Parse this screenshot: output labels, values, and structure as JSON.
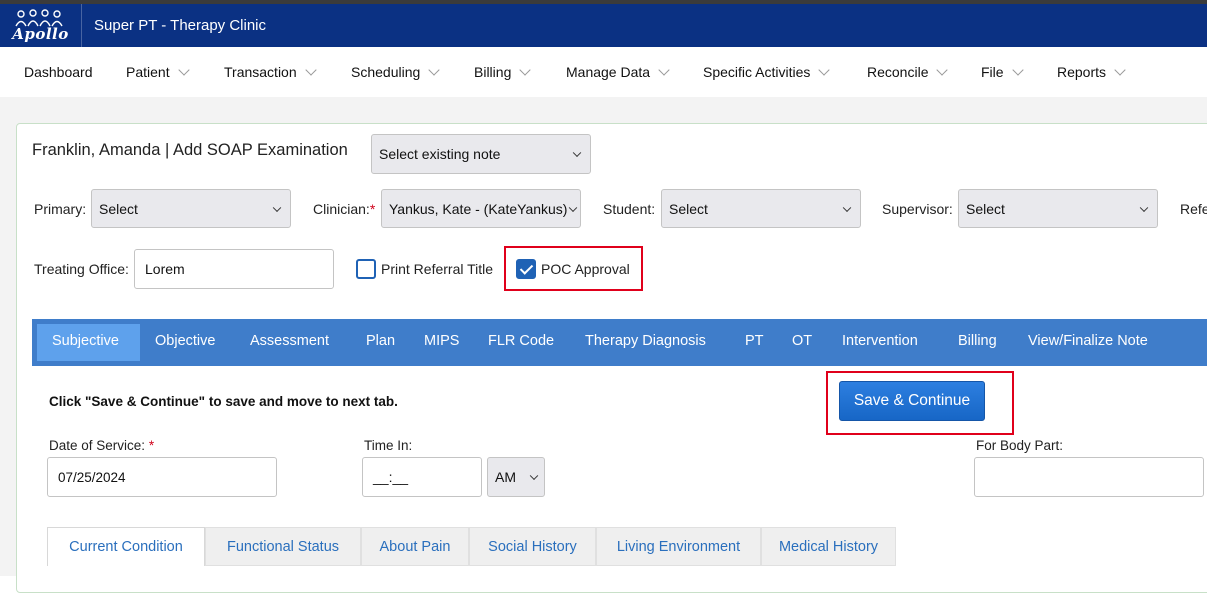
{
  "app": {
    "logo_text": "Apollo",
    "title": "Super PT - Therapy Clinic"
  },
  "nav": [
    {
      "label": "Dashboard",
      "has_menu": false
    },
    {
      "label": "Patient",
      "has_menu": true
    },
    {
      "label": "Transaction",
      "has_menu": true
    },
    {
      "label": "Scheduling",
      "has_menu": true
    },
    {
      "label": "Billing",
      "has_menu": true
    },
    {
      "label": "Manage Data",
      "has_menu": true
    },
    {
      "label": "Specific Activities",
      "has_menu": true
    },
    {
      "label": "Reconcile",
      "has_menu": true
    },
    {
      "label": "File",
      "has_menu": true
    },
    {
      "label": "Reports",
      "has_menu": true
    }
  ],
  "form": {
    "patient_title": "Franklin, Amanda | Add SOAP Examination",
    "existing_note_value": "Select existing note",
    "primary_label": "Primary:",
    "primary_value": "Select",
    "clinician_label": "Clinician:",
    "clinician_required": "*",
    "clinician_value": "Yankus, Kate - (KateYankus)",
    "student_label": "Student:",
    "student_value": "Select",
    "supervisor_label": "Supervisor:",
    "supervisor_value": "Select",
    "referral_label_partial": "Refe",
    "treating_office_label": "Treating Office:",
    "treating_office_value": "Lorem",
    "print_referral_label": "Print Referral Title",
    "print_referral_checked": false,
    "poc_approval_label": "POC Approval",
    "poc_approval_checked": true
  },
  "tabs": [
    {
      "label": "Subjective",
      "active": true
    },
    {
      "label": "Objective",
      "active": false
    },
    {
      "label": "Assessment",
      "active": false
    },
    {
      "label": "Plan",
      "active": false
    },
    {
      "label": "MIPS",
      "active": false
    },
    {
      "label": "FLR Code",
      "active": false
    },
    {
      "label": "Therapy Diagnosis",
      "active": false
    },
    {
      "label": "PT",
      "active": false
    },
    {
      "label": "OT",
      "active": false
    },
    {
      "label": "Intervention",
      "active": false
    },
    {
      "label": "Billing",
      "active": false
    },
    {
      "label": "View/Finalize Note",
      "active": false
    }
  ],
  "subjective": {
    "hint": "Click \"Save & Continue\" to save and move to next tab.",
    "save_label": "Save & Continue",
    "date_label": "Date of Service:",
    "date_required": "*",
    "date_value": "07/25/2024",
    "time_in_label": "Time In:",
    "time_in_value": "__:__",
    "ampm_value": "AM",
    "body_part_label": "For Body Part:",
    "body_part_value": ""
  },
  "subtabs": [
    {
      "label": "Current Condition",
      "active": true
    },
    {
      "label": "Functional Status",
      "active": false
    },
    {
      "label": "About Pain",
      "active": false
    },
    {
      "label": "Social History",
      "active": false
    },
    {
      "label": "Living Environment",
      "active": false
    },
    {
      "label": "Medical History",
      "active": false
    }
  ],
  "colors": {
    "header_bg": "#0b3183",
    "tabbar_bg": "#3f7dca",
    "tab_active_bg": "#5ea1ec",
    "button_bg": "#1f6fd1",
    "highlight_red": "#e0001b",
    "link_blue": "#2a6fbd"
  }
}
